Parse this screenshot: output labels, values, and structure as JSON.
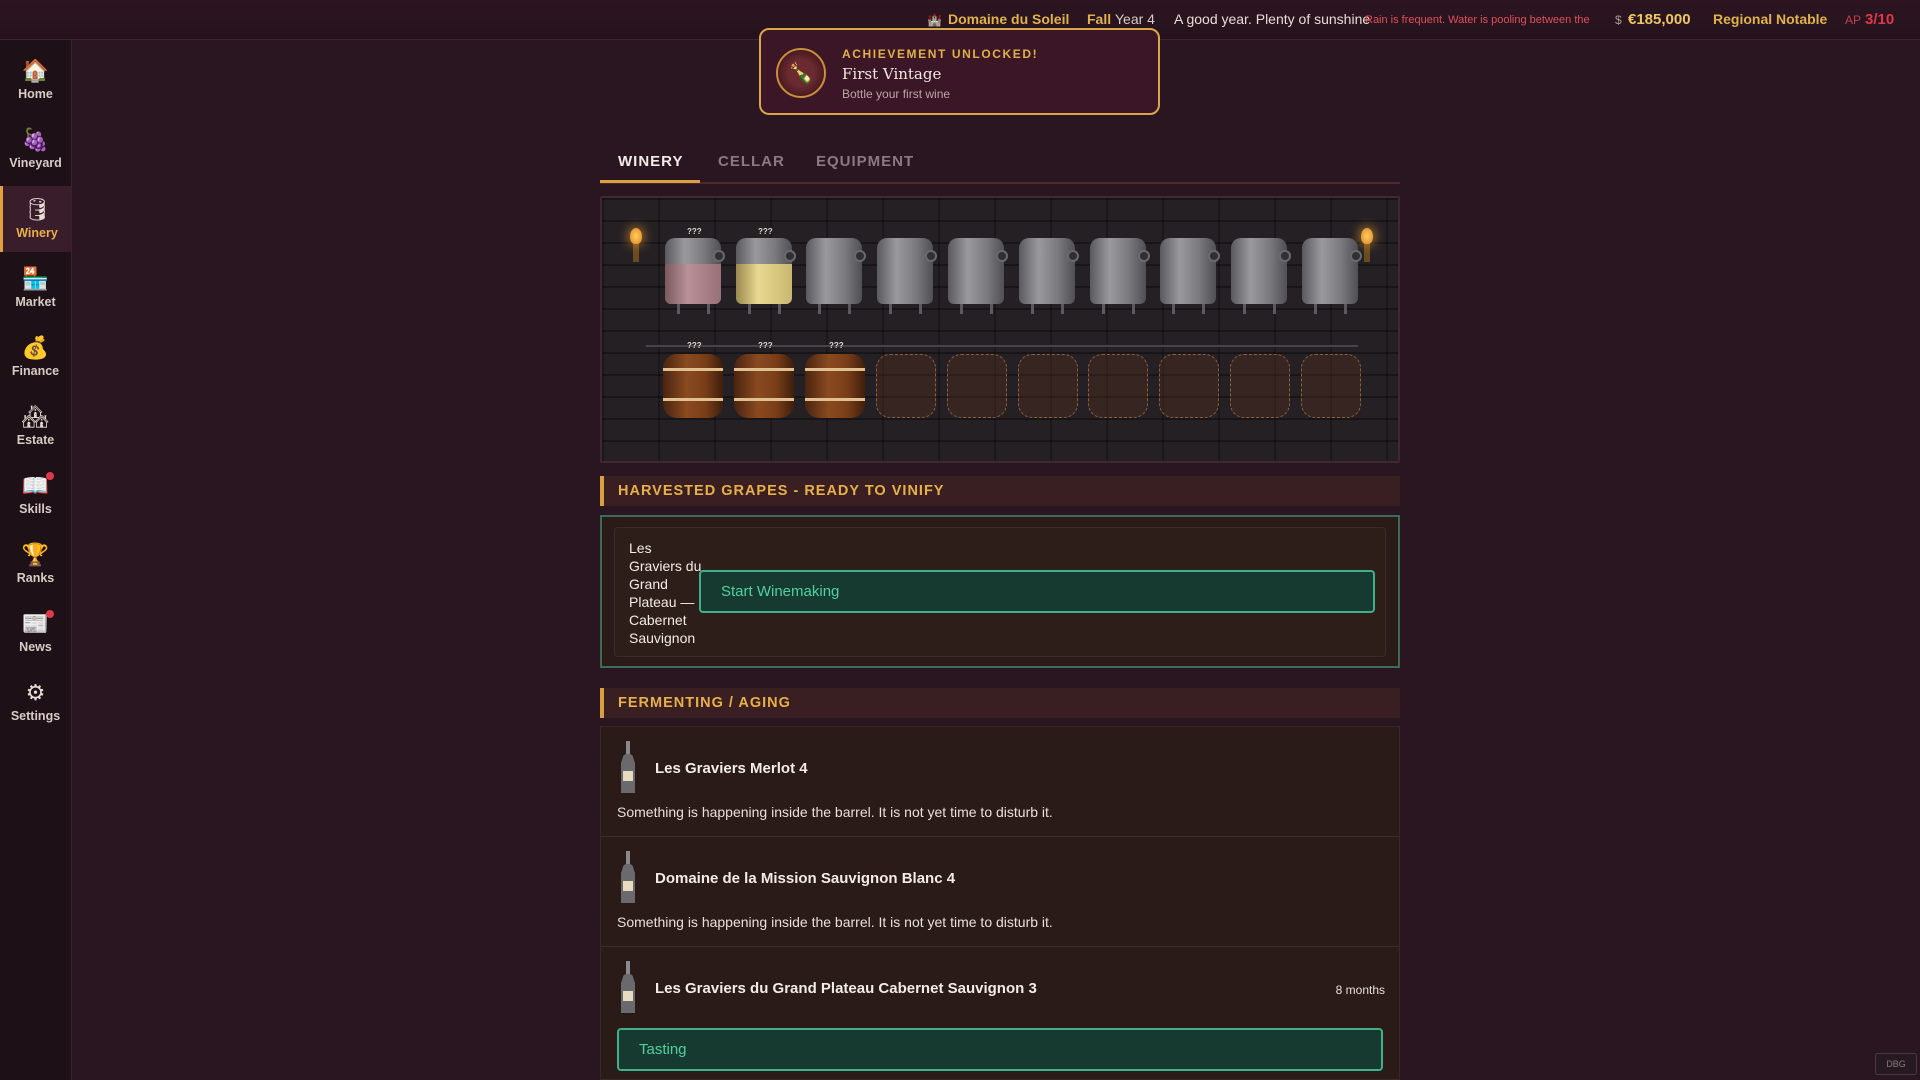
{
  "topbar": {
    "estate": "Domaine du Soleil",
    "season": "Fall",
    "year": "Year 4",
    "weather": "A good year. Plenty of sunshine",
    "weather_warning": "Rain is frequent. Water is pooling between the",
    "money": "€185,000",
    "money_symbol": "$",
    "rank": "Regional Notable",
    "ap_label": "AP",
    "ap_value": "3/10"
  },
  "sidebar": {
    "items": [
      {
        "label": "Home",
        "icon": "house-icon"
      },
      {
        "label": "Vineyard",
        "icon": "grapes-icon"
      },
      {
        "label": "Winery",
        "icon": "barrel-icon"
      },
      {
        "label": "Market",
        "icon": "market-stall-icon"
      },
      {
        "label": "Finance",
        "icon": "money-icon"
      },
      {
        "label": "Estate",
        "icon": "estate-icon"
      },
      {
        "label": "Skills",
        "icon": "book-icon"
      },
      {
        "label": "Ranks",
        "icon": "trophy-icon"
      },
      {
        "label": "News",
        "icon": "newspaper-icon"
      },
      {
        "label": "Settings",
        "icon": "gear-icon"
      }
    ],
    "active": "Winery"
  },
  "achievement": {
    "header": "ACHIEVEMENT UNLOCKED!",
    "title": "First Vintage",
    "description": "Bottle your first wine"
  },
  "tabs": [
    "WINERY",
    "CELLAR",
    "EQUIPMENT"
  ],
  "cellar": {
    "tank_marker": "???",
    "barrel_marker": "???",
    "tanks": [
      {
        "state": "red"
      },
      {
        "state": "white"
      },
      {
        "state": "empty"
      },
      {
        "state": "empty"
      },
      {
        "state": "empty"
      },
      {
        "state": "empty"
      },
      {
        "state": "empty"
      },
      {
        "state": "empty"
      },
      {
        "state": "empty"
      },
      {
        "state": "empty"
      }
    ],
    "barrels": [
      {
        "state": "full"
      },
      {
        "state": "full"
      },
      {
        "state": "full"
      },
      {
        "state": "empty"
      },
      {
        "state": "empty"
      },
      {
        "state": "empty"
      },
      {
        "state": "empty"
      },
      {
        "state": "empty"
      },
      {
        "state": "empty"
      },
      {
        "state": "empty"
      }
    ]
  },
  "harvest": {
    "heading": "HARVESTED GRAPES - READY TO VINIFY",
    "lot_name": "Les Graviers du Grand Plateau — Cabernet Sauvignon",
    "button": "Start Winemaking"
  },
  "aging": {
    "heading": "FERMENTING / AGING",
    "items": [
      {
        "title": "Les Graviers Merlot 4",
        "description": "Something is happening inside the barrel. It is not yet time to disturb it."
      },
      {
        "title": "Domaine de la Mission Sauvignon Blanc 4",
        "description": "Something is happening inside the barrel. It is not yet time to disturb it."
      },
      {
        "title": "Les Graviers du Grand Plateau Cabernet Sauvignon 3",
        "time": "8 months",
        "button": "Tasting"
      }
    ]
  },
  "debug_label": "DBG",
  "colors": {
    "accent": "#e0b24a",
    "green_button": "#3fb08a",
    "warning": "#e0505a"
  }
}
